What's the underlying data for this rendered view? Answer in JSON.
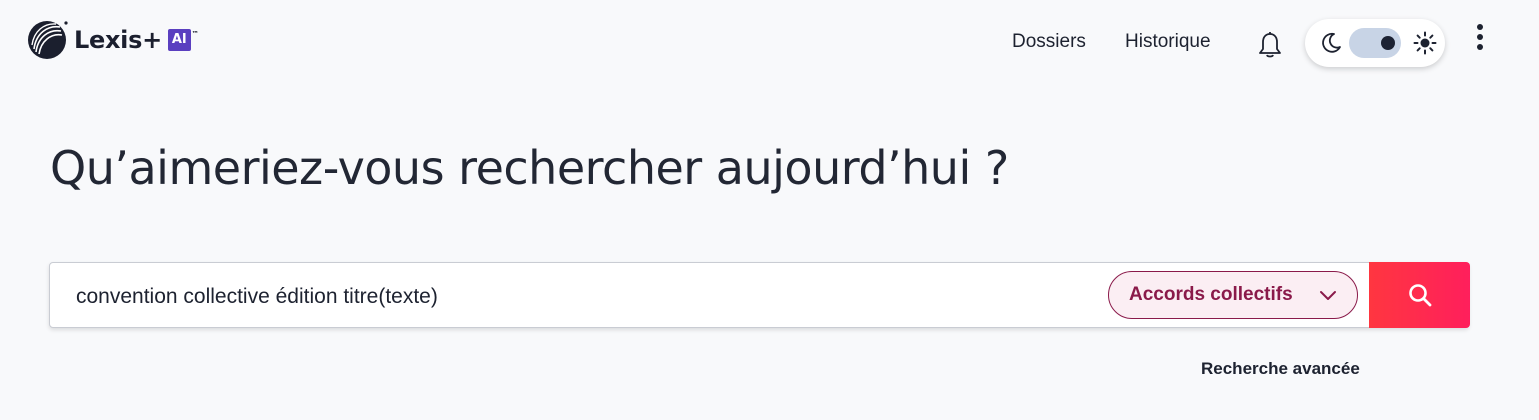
{
  "header": {
    "brand_name": "Lexis+",
    "brand_badge": "AI",
    "nav": {
      "dossiers": "Dossiers",
      "historique": "Historique"
    },
    "icons": {
      "notifications": "bell-icon",
      "theme_dark": "moon-icon",
      "theme_light": "sun-icon",
      "more": "kebab-menu-icon"
    },
    "theme_toggle_state": "dark-knob-right"
  },
  "main": {
    "headline": "Qu’aimeriez-vous rechercher aujourd’hui ?",
    "search": {
      "value": "convention collective édition titre(texte)",
      "scope_label": "Accords collectifs",
      "button_icon": "search-icon"
    },
    "advanced_search": "Recherche avancée"
  },
  "colors": {
    "accent_pink": "#ff2a4d",
    "scope_border": "#8a1a4a",
    "scope_fill": "#fbeef3",
    "badge_purple": "#5a3fc0"
  }
}
